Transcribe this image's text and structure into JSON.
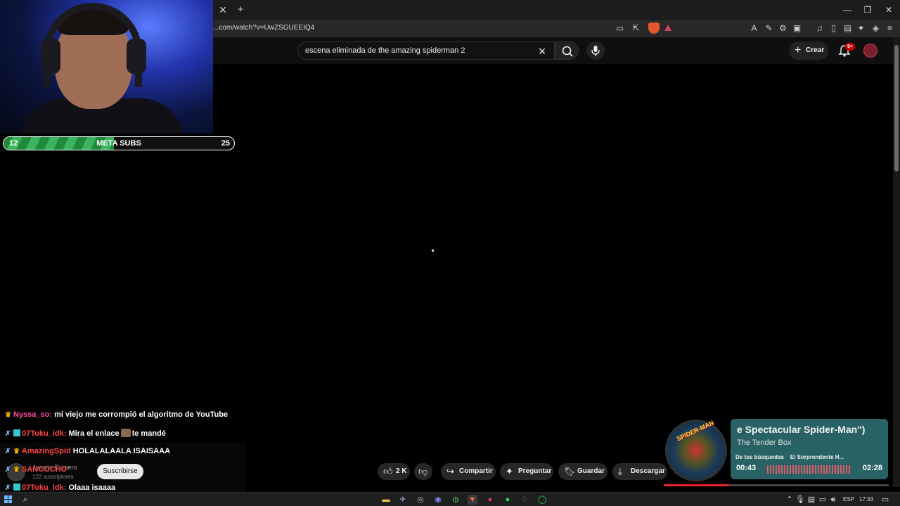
{
  "browser": {
    "url": "...com/watch?v=UwZSGUEEIQ4",
    "tab_close": "✕",
    "tab_new": "+",
    "window_controls": [
      "—",
      "❐",
      "✕"
    ]
  },
  "youtube": {
    "search_query": "escena eliminada de the amazing spiderman 2",
    "create_label": "Crear",
    "notification_badge": "9+",
    "actions": {
      "like_count": "2 K",
      "share": "Compartir",
      "ask": "Preguntar",
      "save": "Guardar",
      "download": "Descargar"
    },
    "channel": {
      "name": "Juanito Romero",
      "subscribers": "122 suscriptores",
      "subscribe_label": "Suscribirse"
    }
  },
  "subgoal": {
    "current": "12",
    "label": "META SUBS",
    "target": "25",
    "progress_fraction": 0.48
  },
  "chat": [
    {
      "user": "Nyssa_so:",
      "user_color": "pink",
      "badges": [
        "crown"
      ],
      "message": "mi viejo me corrompió el algoritmo de YouTube"
    },
    {
      "user": "07Toku_idk:",
      "user_color": "red",
      "badges": [
        "sword",
        "qr"
      ],
      "message_before": "Mira el enlace",
      "message_after": "te mandé"
    },
    {
      "user": "AmazingSpid",
      "user_color": "red",
      "badges": [
        "sword",
        "crown"
      ],
      "message": "HOLALALAALA ISAISAAA"
    },
    {
      "user": "SANCOCHO",
      "user_color": "red",
      "badges": [
        "sword",
        "crown"
      ],
      "message": ""
    },
    {
      "user": "07Toku_idk:",
      "user_color": "red",
      "badges": [
        "sword",
        "qr"
      ],
      "message": "Olaaa isaaaa"
    }
  ],
  "music": {
    "title": "e Spectacular Spider-Man\")",
    "artist": "The Tender Box",
    "sub_tabs": [
      "De tus búsquedas",
      "El Sorprendente H..."
    ],
    "time_elapsed": "00:43",
    "time_total": "02:28",
    "progress_fraction": 0.29,
    "disc_label": "SPIDER-MAN"
  },
  "taskbar": {
    "language": "ESP",
    "time": "17:33"
  },
  "colors": {
    "subbar_green": "#3bb45d",
    "music_card": "#2c6a6e",
    "youtube_red": "#cc0000"
  }
}
